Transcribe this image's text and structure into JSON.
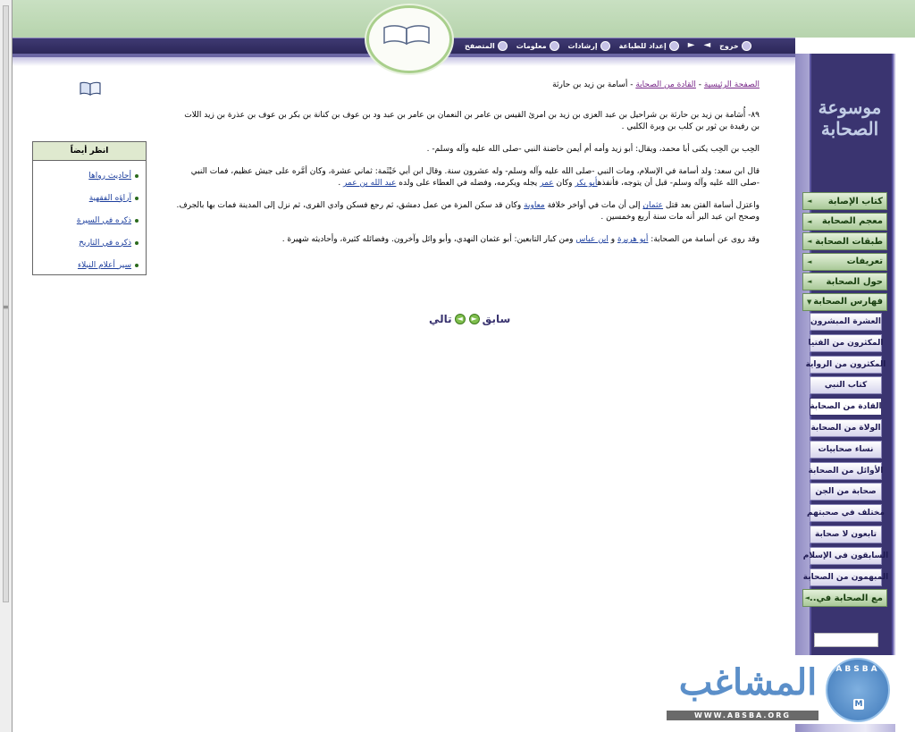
{
  "toolbar": {
    "items": [
      "المتصفح",
      "معلومات",
      "إرشادات",
      "إعداد للطباعة",
      "خروج"
    ],
    "nav_arrows": [
      "►",
      "◄"
    ]
  },
  "site_title": [
    "موسوعة",
    "الصحابة"
  ],
  "sidebar": {
    "green_items": [
      "كتاب الإصابة",
      "معجم الصحابة",
      "طبقات الصحابة",
      "تعريفات",
      "حول الصحابة",
      "فهارس الصحابة"
    ],
    "sub_items": [
      "العشرة المبشرون",
      "المكثرون من الفتيا",
      "المكثرون من الرواية",
      "كتاب النبي",
      "القادة من الصحابة",
      "الولاة من الصحابة",
      "نساء صحابيات",
      "الأوائل من الصحابة",
      "صحابة من الجن",
      "مختلف في صحبتهم",
      "تابعون لا صحابة",
      "السابقون في الإسلام",
      "المبهمون من الصحابة"
    ],
    "active_item": "القادة من الصحابة",
    "last_green": "مع الصحابة في..",
    "arrow": "◄"
  },
  "breadcrumb": {
    "home": "الصفحة الرئيسية",
    "section": "القادة من الصحابة",
    "sep": " - ",
    "current": "أسامة بن زيد بن حارثة"
  },
  "article": {
    "p1": "٨٩- أُسَامة بن زيد بن حارثة بن شراحيل بن عبد العزى بن زيد بن امرئ القيس بن عامر بن النعمان بن عامر بن عبد ود بن عوف بن كنانة بن بكر بن عوف بن عذرة بن زيد اللات بن رفيدة بن ثور بن كلب بن وبرة الكلبي .",
    "p2": "الحِب بن الحِب يكنى أبا محمد، ويقال: أبو زيد وأمه أم أيمن حاضنة النبي -صلى الله عليه وآله وسلم- .",
    "p3_a": "قال ابن سعد: ولد أسامة في الإسلام، ومات النبي -صلى الله عليه وآله وسلم- وله عشرون سنة. وقال ابن أبي خَيْثَمة: ثماني عشرة، وكان أمَّره على جيش عظيم، فمات النبي -صلى الله عليه وآله وسلم- قبل أن يتوجه، فأنفذه",
    "p3_link1": "أبو بكر",
    "p3_b": " وكان ",
    "p3_link2": "عمر",
    "p3_c": " يجله ويكرمه، وفضله في العطاء على ولده ",
    "p3_link3": "عبد الله بن عمر",
    "p3_d": " .",
    "p4_a": "واعتزل أسامة الفتن بعد قتل ",
    "p4_link1": "عثمان",
    "p4_b": " إلى أن مات في أواخر خلافة ",
    "p4_link2": "معاوية",
    "p4_c": " وكان قد سكن المزة من عمل دمشق، ثم رجع فسكن وادي القرى، ثم نزل إلى المدينة فمات بها بالجرف. وصحح ابن عبد البر أنه مات سنة أربع وخمسين .",
    "p5_a": "وقد روى عن أسامة من الصحابة: ",
    "p5_link1": "أبو هريرة",
    "p5_b": " و ",
    "p5_link2": "ابن عباس",
    "p5_c": " ومن كبار التابعين: أبو عثمان النهدي، وأبو وائل وآخرون. وفضائله كثيرة، وأحاديثه شهيرة ."
  },
  "see_also": {
    "title": "انظر أيضاً",
    "items": [
      "أحاديث رواها",
      "آراؤه الفقهية",
      "ذكره في السيرة",
      "ذكره في التاريخ",
      "سير أعلام النبلاء"
    ]
  },
  "pager": {
    "prev": "سابق",
    "next": "تالي"
  },
  "watermark": {
    "name": "المشاغب",
    "url": "WWW.ABSBA.ORG",
    "badge": "ABSBA",
    "badge_letter": "M"
  },
  "colors": {
    "header_green": "#b7d4ad",
    "header_purple": "#2b2657",
    "sidebar_panel": "#3a3470",
    "menu_green": "#a9c998",
    "link_blue": "#1d3f9e",
    "breadcrumb_link": "#7a2a8a"
  }
}
